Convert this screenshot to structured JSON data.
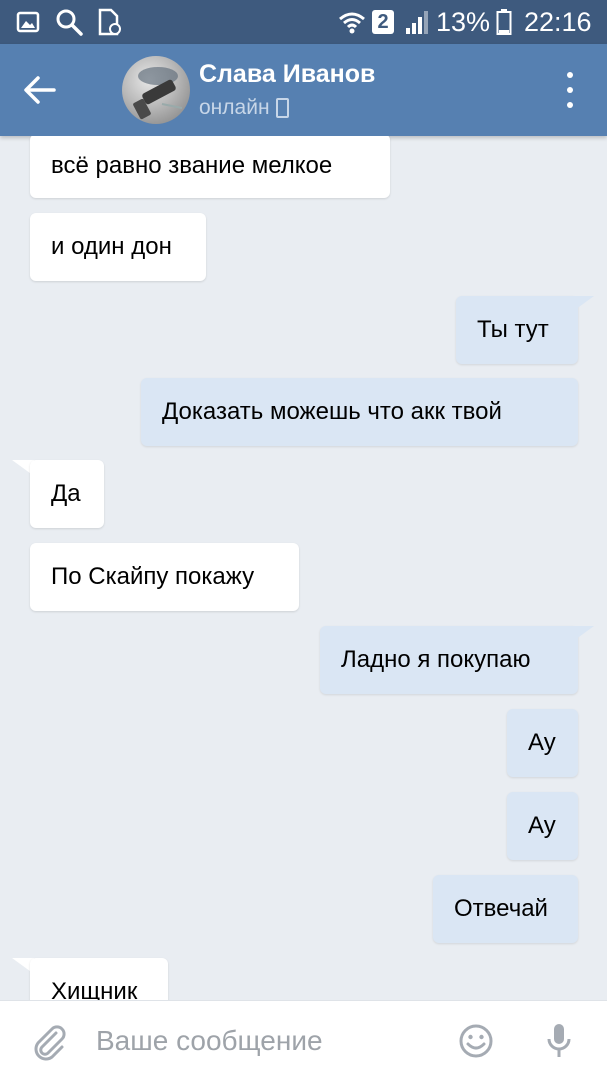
{
  "status_bar": {
    "sim_badge": "2",
    "battery_text": "13%",
    "time": "22:16",
    "icons": [
      "gallery-icon",
      "search-icon",
      "file-icon",
      "wifi-icon",
      "signal-icon",
      "battery-icon"
    ]
  },
  "header": {
    "name": "Слава Иванов",
    "status": "онлайн",
    "colors": {
      "bar": "#5680b1",
      "status_bar": "#3e5a7e"
    }
  },
  "messages": [
    {
      "direction": "in",
      "text": "всё равно звание мелкое"
    },
    {
      "direction": "in",
      "text": "и один дон"
    },
    {
      "direction": "out",
      "text": "Ты тут"
    },
    {
      "direction": "out",
      "text": "Доказать можешь что акк твой"
    },
    {
      "direction": "in",
      "text": "Да"
    },
    {
      "direction": "in",
      "text": "По Скайпу покажу"
    },
    {
      "direction": "out",
      "text": "Ладно я покупаю"
    },
    {
      "direction": "out",
      "text": "Ау"
    },
    {
      "direction": "out",
      "text": "Ау"
    },
    {
      "direction": "out",
      "text": "Отвечай"
    },
    {
      "direction": "in",
      "text": "Хищник"
    }
  ],
  "composer": {
    "placeholder": "Ваше сообщение"
  },
  "colors": {
    "background": "#e9edf2",
    "incoming_bubble": "#ffffff",
    "outgoing_bubble": "#dae6f4"
  }
}
